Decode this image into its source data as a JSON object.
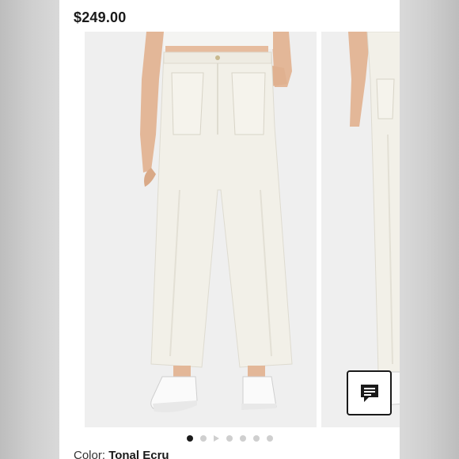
{
  "product": {
    "price": "$249.00",
    "color_label": "Color:",
    "color_value": "Tonal Ecru"
  },
  "carousel": {
    "slide_count": 7,
    "active_index": 0,
    "video_index": 2
  },
  "icons": {
    "chat": "chat-bubble-icon",
    "video": "play-icon"
  },
  "colors": {
    "text": "#1a1a1a",
    "dot_active": "#1a1a1a",
    "dot_inactive": "#cfcfcf",
    "pants": "#f2f0e8"
  }
}
